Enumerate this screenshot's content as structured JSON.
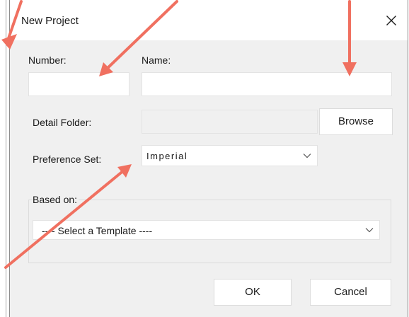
{
  "dialog": {
    "title": "New Project",
    "close_glyph": "✕",
    "number_label": "Number:",
    "number_value": "",
    "name_label": "Name:",
    "name_value": "",
    "detail_folder_label": "Detail Folder:",
    "detail_folder_value": "",
    "browse_label": "Browse",
    "preference_set_label": "Preference Set:",
    "preference_set_value": "Imperial",
    "based_on_label": "Based on:",
    "template_value": "---- Select a Template ----",
    "ok_label": "OK",
    "cancel_label": "Cancel"
  },
  "icons": {
    "close": "close-icon",
    "dropdown": "chevron-down-icon"
  },
  "colors": {
    "dialog_bg": "#f0f0f0",
    "titlebar_bg": "#ffffff",
    "annotation_arrow": "#f07060"
  }
}
